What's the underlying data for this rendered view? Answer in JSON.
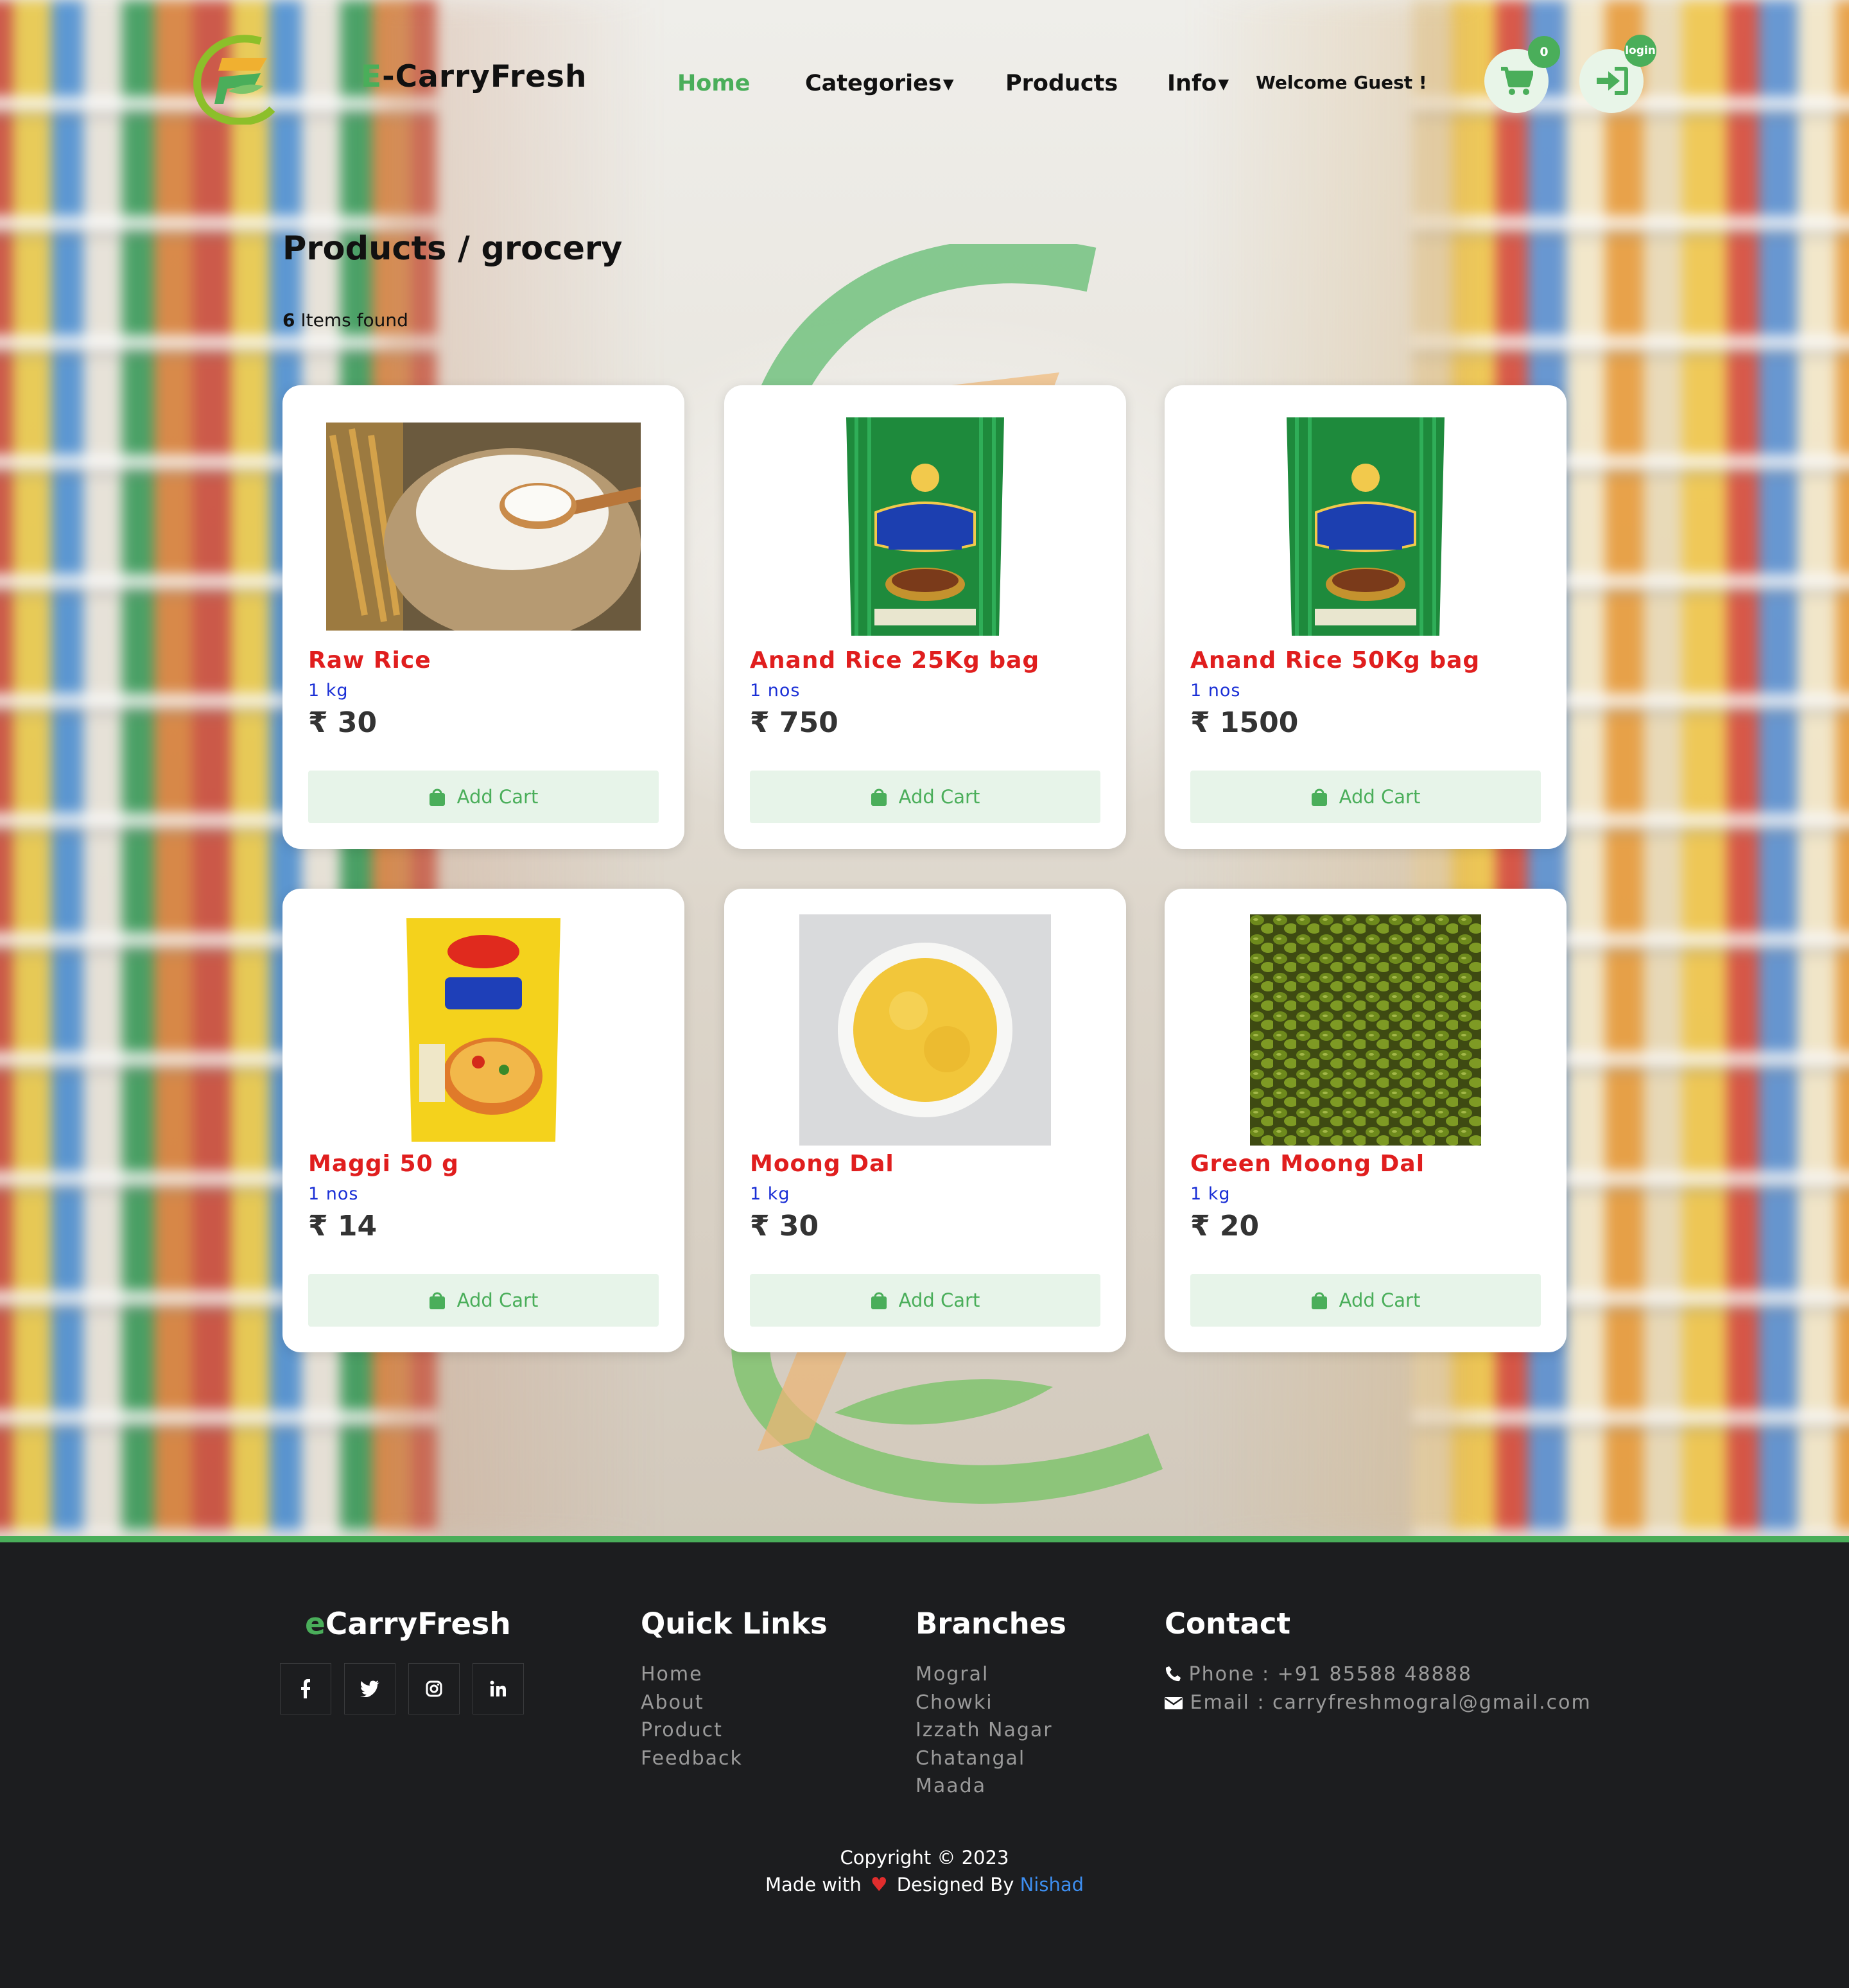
{
  "header": {
    "brand_first": "E",
    "brand_rest": "-CarryFresh",
    "nav": {
      "home": "Home",
      "categories": "Categories",
      "products": "Products",
      "info": "Info"
    },
    "welcome": "Welcome Guest !",
    "cart_count": "0",
    "login_badge": "login"
  },
  "page": {
    "title": "Products / grocery",
    "items_count": "6",
    "items_label": " Items found"
  },
  "products": [
    {
      "name": "Raw Rice",
      "unit": "1 kg",
      "price": "₹ 30",
      "button": "Add Cart",
      "image": "rice-sack"
    },
    {
      "name": "Anand Rice 25Kg bag",
      "unit": "1 nos",
      "price": "₹ 750",
      "button": "Add Cart",
      "image": "rice-bag-green"
    },
    {
      "name": "Anand Rice 50Kg bag",
      "unit": "1 nos",
      "price": "₹ 1500",
      "button": "Add Cart",
      "image": "rice-bag-green"
    },
    {
      "name": "Maggi 50 g",
      "unit": "1 nos",
      "price": "₹ 14",
      "button": "Add Cart",
      "image": "noodle-pack"
    },
    {
      "name": "Moong Dal",
      "unit": "1 kg",
      "price": "₹ 30",
      "button": "Add Cart",
      "image": "dal-bowl"
    },
    {
      "name": "Green Moong Dal",
      "unit": "1 kg",
      "price": "₹ 20",
      "button": "Add Cart",
      "image": "green-beans"
    }
  ],
  "footer": {
    "brand_first": "e",
    "brand_rest": "CarryFresh",
    "quick_links_title": "Quick Links",
    "quick_links": [
      "Home",
      "About",
      "Product",
      "Feedback"
    ],
    "branches_title": "Branches",
    "branches": [
      "Mogral",
      "Chowki",
      "Izzath Nagar",
      "Chatangal",
      "Maada"
    ],
    "contact_title": "Contact",
    "phone": "Phone : +91 85588 48888",
    "email": "Email : carryfreshmogral@gmail.com",
    "copyright": "Copyright © 2023",
    "made_with": "Made with",
    "designed_by": "Designed By",
    "designer": "Nishad"
  },
  "colors": {
    "accent": "#4aae5a",
    "product_name": "#e01e1e",
    "unit": "#1a2fd6",
    "footer_bg": "#1c1d1f",
    "link": "#3d8ef0"
  }
}
